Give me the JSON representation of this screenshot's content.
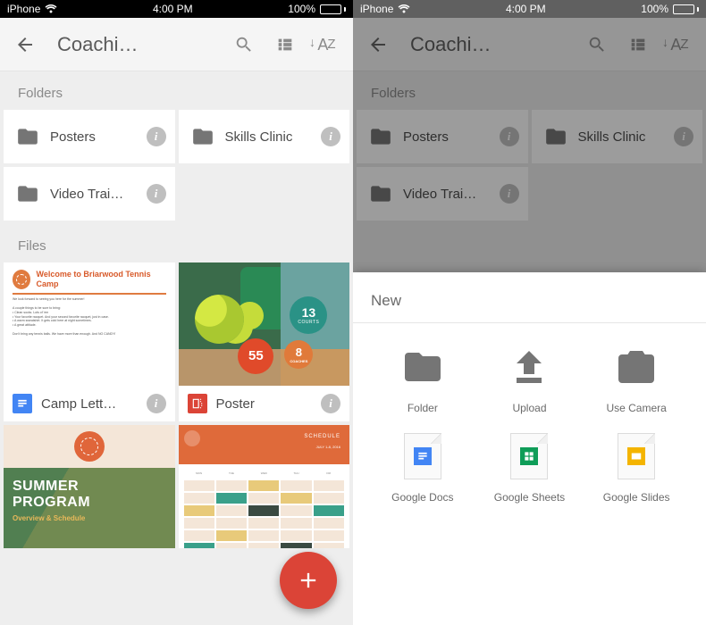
{
  "status_bar": {
    "carrier": "iPhone",
    "time": "4:00 PM",
    "battery_pct": "100%"
  },
  "header": {
    "title": "Coachi…"
  },
  "sections": {
    "folders": "Folders",
    "files": "Files"
  },
  "folders": [
    {
      "name": "Posters"
    },
    {
      "name": "Skills Clinic"
    },
    {
      "name": "Video Trai…"
    }
  ],
  "files": [
    {
      "name": "Camp Lett…",
      "type": "docs",
      "type_color": "#4285F4"
    },
    {
      "name": "Poster",
      "type": "drawings",
      "type_color": "#DB4437"
    }
  ],
  "thumb": {
    "camp": {
      "welcome": "Welcome to Briarwood Tennis Camp"
    },
    "poster": {
      "badge13": "13",
      "badge13_sub": "COURTS",
      "badge8": "8",
      "badge8_sub": "COACHES",
      "badge55": "55"
    },
    "summer": {
      "line1": "SUMMER",
      "line2": "PROGRAM",
      "line3": "Overview & Schedule"
    }
  },
  "sheet": {
    "title": "New",
    "items": [
      {
        "label": "Folder"
      },
      {
        "label": "Upload"
      },
      {
        "label": "Use Camera"
      },
      {
        "label": "Google Docs",
        "color": "#4285F4"
      },
      {
        "label": "Google Sheets",
        "color": "#0F9D58"
      },
      {
        "label": "Google Slides",
        "color": "#F4B400"
      }
    ]
  }
}
